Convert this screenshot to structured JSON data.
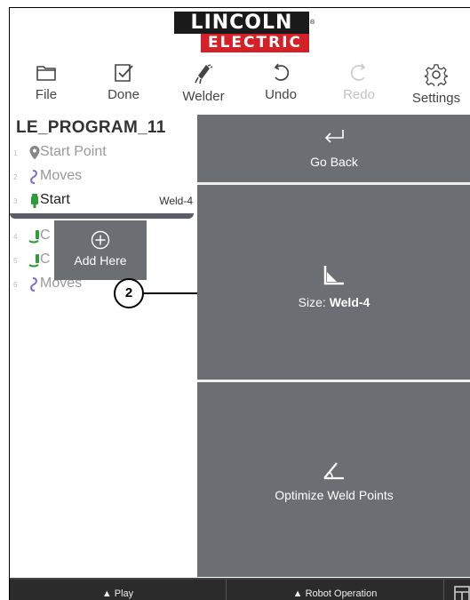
{
  "logo": {
    "line1": "LINCOLN",
    "line2": "ELECTRIC",
    "reg": "®",
    "colors": {
      "dark": "#1a1a1a",
      "red": "#d42026"
    }
  },
  "toolbar": [
    {
      "label": "File",
      "icon": "folder-icon",
      "enabled": true
    },
    {
      "label": "Done",
      "icon": "checkbox-icon",
      "enabled": true
    },
    {
      "label": "Welder",
      "icon": "welder-icon",
      "enabled": true
    },
    {
      "label": "Undo",
      "icon": "undo-icon",
      "enabled": true
    },
    {
      "label": "Redo",
      "icon": "redo-icon",
      "enabled": false
    },
    {
      "label": "Settings",
      "icon": "gear-icon",
      "enabled": true
    }
  ],
  "program": {
    "title": "LE_PROGRAM_11",
    "rows": [
      {
        "num": "1",
        "label": "Start Point",
        "icon": "location-pin-icon",
        "extra": ""
      },
      {
        "num": "2",
        "label": "Moves",
        "icon": "moves-icon",
        "extra": ""
      },
      {
        "num": "3",
        "label": "Start",
        "icon": "torch-start-icon",
        "extra": "Weld-4"
      },
      {
        "num": "4",
        "label": "C",
        "icon": "weld-icon",
        "extra": ""
      },
      {
        "num": "5",
        "label": "C",
        "icon": "weld-icon",
        "extra": ""
      },
      {
        "num": "6",
        "label": "Moves",
        "icon": "moves-icon",
        "extra": ""
      }
    ]
  },
  "add_here": {
    "label": "Add Here",
    "icon": "plus-circle-icon"
  },
  "right_panel": {
    "go_back": {
      "label": "Go Back",
      "icon": "return-arrow-icon"
    },
    "size": {
      "prefix": "Size: ",
      "value": "Weld-4",
      "icon": "fillet-weld-icon"
    },
    "optimize": {
      "label": "Optimize Weld Points",
      "icon": "angle-icon"
    }
  },
  "bottom_bar": {
    "play": "▲ Play",
    "robot_operation": "▲ Robot Operation",
    "panel_icon": "panel-icon"
  },
  "callout": {
    "number": "2"
  },
  "colors": {
    "panel_gray": "#6b6e73",
    "bottom_bar": "#2b2b2b",
    "move_blue": "#7b6bd6",
    "torch_green": "#2e9c3a"
  }
}
